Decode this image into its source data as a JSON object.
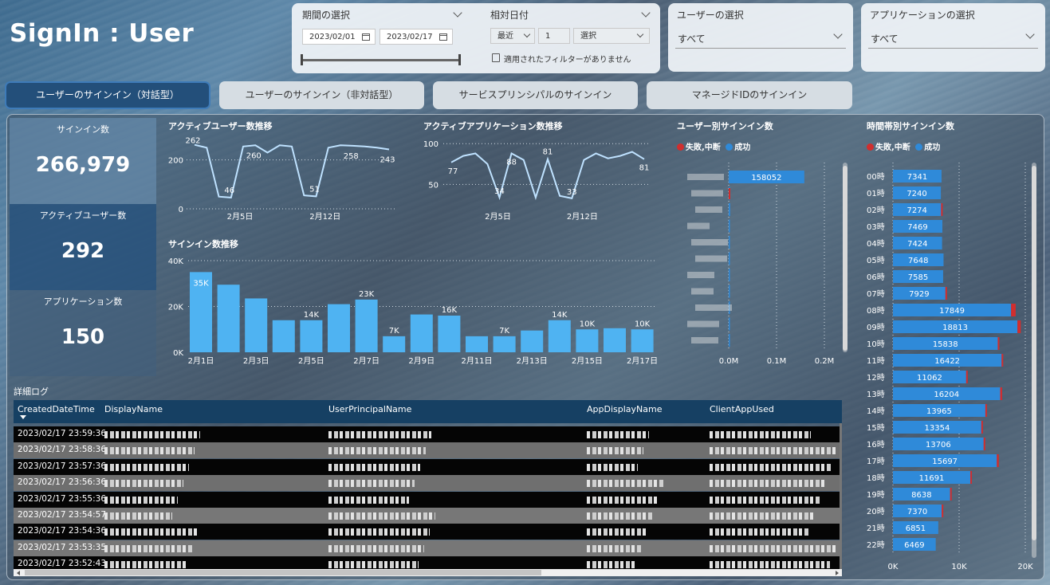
{
  "title": "SignIn : User",
  "period_slicer": {
    "label": "期間の選択",
    "start": "2023/02/01",
    "end": "2023/02/17"
  },
  "relative_slicer": {
    "label": "相対日付",
    "mode": "最近",
    "count": "1",
    "unit": "選択",
    "note": "適用されたフィルターがありません"
  },
  "user_slicer": {
    "label": "ユーザーの選択",
    "value": "すべて"
  },
  "app_slicer": {
    "label": "アプリケーションの選択",
    "value": "すべて"
  },
  "tabs": [
    {
      "label": "ユーザーのサインイン（対話型）"
    },
    {
      "label": "ユーザーのサインイン（非対話型）"
    },
    {
      "label": "サービスプリンシパルのサインイン"
    },
    {
      "label": "マネージドIDのサインイン"
    }
  ],
  "kpis": [
    {
      "label": "サインイン数",
      "value": "266,979"
    },
    {
      "label": "アクティブユーザー数",
      "value": "292"
    },
    {
      "label": "アプリケーション数",
      "value": "150"
    }
  ],
  "colors": {
    "success": "#2f8ad9",
    "failure": "#d12e2e",
    "bar": "#4fb3f2",
    "line": "#bfe2ff"
  },
  "legend": {
    "failure": "失敗,中断",
    "success": "成功"
  },
  "active_users_chart": {
    "title": "アクティブユーザー数推移",
    "y_ticks": [
      "200",
      "0"
    ],
    "x_ticks": [
      "2月5日",
      "2月12日"
    ],
    "values": [
      262,
      250,
      50,
      46,
      255,
      260,
      230,
      260,
      255,
      55,
      51,
      250,
      260,
      258,
      255,
      250,
      243
    ],
    "labels": [
      "262",
      "46",
      "260",
      "51",
      "258",
      "243"
    ]
  },
  "active_apps_chart": {
    "title": "アクティブアプリケーション数推移",
    "y_ticks": [
      "100",
      "50"
    ],
    "x_ticks": [
      "2月5日",
      "2月12日"
    ],
    "values": [
      77,
      85,
      88,
      75,
      34,
      88,
      80,
      34,
      81,
      36,
      33,
      80,
      88,
      82,
      85,
      90,
      81
    ],
    "labels": [
      "77",
      "34",
      "88",
      "81",
      "33",
      "81"
    ]
  },
  "signin_chart": {
    "title": "サインイン数推移",
    "y_ticks": [
      "40K",
      "20K",
      "0K"
    ],
    "x_ticks": [
      "2月1日",
      "2月3日",
      "2月5日",
      "2月7日",
      "2月9日",
      "2月11日",
      "2月13日",
      "2月15日",
      "2月17日"
    ],
    "values": [
      35,
      29.5,
      23.5,
      14,
      14,
      21,
      23,
      7,
      16.5,
      16,
      7,
      7,
      9.5,
      14,
      10,
      10.5,
      10
    ],
    "labels": [
      "35K",
      "",
      "",
      "",
      "14K",
      "",
      "23K",
      "7K",
      "",
      "16K",
      "",
      "7K",
      "",
      "14K",
      "10K",
      "",
      "10K"
    ]
  },
  "user_signin_chart": {
    "title": "ユーザー別サインイン数",
    "x_ticks": [
      "0.0M",
      "0.1M",
      "0.2M"
    ],
    "top_value": "158052"
  },
  "hourly_chart": {
    "title": "時間帯別サインイン数",
    "hours": [
      "00時",
      "01時",
      "02時",
      "03時",
      "04時",
      "05時",
      "06時",
      "07時",
      "08時",
      "09時",
      "10時",
      "11時",
      "12時",
      "13時",
      "14時",
      "15時",
      "16時",
      "17時",
      "18時",
      "19時",
      "20時",
      "21時",
      "22時"
    ],
    "success": [
      7341,
      7240,
      7274,
      7469,
      7424,
      7648,
      7585,
      7929,
      17849,
      18813,
      15838,
      16422,
      11062,
      16204,
      13965,
      13354,
      13706,
      15697,
      11691,
      8638,
      7370,
      6851,
      6469
    ],
    "failure": [
      0,
      0,
      200,
      0,
      0,
      0,
      0,
      100,
      700,
      500,
      200,
      200,
      150,
      300,
      150,
      150,
      150,
      300,
      150,
      100,
      100,
      0,
      0
    ],
    "x_ticks": [
      "0K",
      "10K",
      "20K"
    ]
  },
  "log": {
    "title": "詳細ログ",
    "columns": [
      "CreatedDateTime",
      "DisplayName",
      "UserPrincipalName",
      "AppDisplayName",
      "ClientAppUsed"
    ],
    "rows": [
      "2023/02/17 23:59:36",
      "2023/02/17 23:58:36",
      "2023/02/17 23:57:36",
      "2023/02/17 23:56:36",
      "2023/02/17 23:55:36",
      "2023/02/17 23:54:57",
      "2023/02/17 23:54:36",
      "2023/02/17 23:53:35",
      "2023/02/17 23:52:43"
    ]
  }
}
